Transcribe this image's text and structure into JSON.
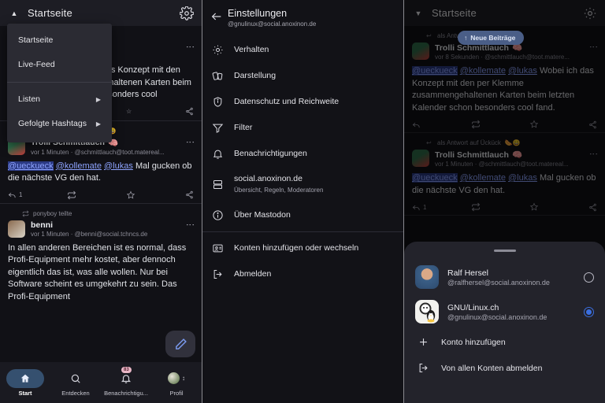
{
  "left": {
    "appbar": {
      "title": "Startseite",
      "chevron": "chevron-up",
      "gear": "gear-icon"
    },
    "menu": {
      "items": [
        {
          "label": "Startseite",
          "submenu": false
        },
        {
          "label": "Live-Feed",
          "submenu": false
        },
        {
          "label": "Listen",
          "submenu": true
        },
        {
          "label": "Gefolgte Hashtags",
          "submenu": true
        }
      ]
    },
    "posts": [
      {
        "context": "als Antwort auf Ückück",
        "name": "Trolli Schmittlauch",
        "handle": "vor 1 Minuten · @schmittlauch@toot.matereal...",
        "mentions": [
          "@ueckueck",
          "@kollemate",
          "@lukas"
        ],
        "text": "Mal gucken ob die nächste VG den hat.",
        "reply_count": "1"
      },
      {
        "context": "ponyboy teilte",
        "name": "benni",
        "handle": "vor 1 Minuten · @benni@social.tchncs.de",
        "mentions": [],
        "text": "In allen anderen Bereichen ist es normal, dass Profi-Equipment mehr kostet, aber dennoch eigentlich das ist, was alle wollen. Nur bei Software scheint es umgekehrt zu sein. Das Profi-Equipment",
        "reply_count": ""
      }
    ],
    "hidden_post": {
      "handle": "ittlauch@toot.matere...",
      "mentions": [
        "mate",
        "@lukas"
      ],
      "text": "Wobei ich das Konzept mit den per Klemme zusammengehaltenen Karten beim letzten Kalender schon besonders cool"
    },
    "fab": "compose-pencil-icon",
    "nav": [
      {
        "label": "Start",
        "icon": "home-icon",
        "selected": true,
        "badge": ""
      },
      {
        "label": "Entdecken",
        "icon": "search-icon",
        "selected": false,
        "badge": ""
      },
      {
        "label": "Benachrichtigu...",
        "icon": "bell-icon",
        "selected": false,
        "badge": "83"
      },
      {
        "label": "Profil",
        "icon": "avatar-icon",
        "selected": false,
        "badge": ""
      }
    ]
  },
  "middle": {
    "header": {
      "back": "back-arrow-icon",
      "title": "Einstellungen",
      "subtitle": "@gnulinux@social.anoxinon.de"
    },
    "items": [
      {
        "label": "Verhalten",
        "sub": "",
        "icon": "gear-icon"
      },
      {
        "label": "Darstellung",
        "sub": "",
        "icon": "palette-icon"
      },
      {
        "label": "Datenschutz und Reichweite",
        "sub": "",
        "icon": "shield-icon"
      },
      {
        "label": "Filter",
        "sub": "",
        "icon": "filter-icon"
      },
      {
        "label": "Benachrichtigungen",
        "sub": "",
        "icon": "bell-icon"
      },
      {
        "label": "social.anoxinon.de",
        "sub": "Übersicht, Regeln, Moderatoren",
        "icon": "server-icon"
      },
      {
        "label": "Über Mastodon",
        "sub": "",
        "icon": "info-icon"
      },
      {
        "label": "Konten hinzufügen oder wechseln",
        "sub": "",
        "icon": "switch-account-icon"
      },
      {
        "label": "Abmelden",
        "sub": "",
        "icon": "logout-icon"
      }
    ]
  },
  "right": {
    "appbar": {
      "title": "Startseite",
      "chevron": "chevron-down",
      "gear": "gear-icon"
    },
    "new_posts_pill": "Neue Beiträge",
    "posts": [
      {
        "context": "als Antwort auf",
        "name": "Trolli Schmittlauch",
        "handle": "vor 8 Sekunden · @schmittlauch@toot.matere...",
        "mentions": [
          "@ueckueck",
          "@kollemate",
          "@lukas"
        ],
        "text": "Wobei ich das Konzept mit den per Klemme zusammengehaltenen Karten beim letzten Kalender schon besonders cool fand.",
        "reply_count": ""
      },
      {
        "context": "als Antwort auf Ückück",
        "name": "Trolli Schmittlauch",
        "handle": "vor 1 Minuten · @schmittlauch@toot.matereal...",
        "mentions": [
          "@ueckueck",
          "@kollemate",
          "@lukas"
        ],
        "text": "Mal gucken ob die nächste VG den hat.",
        "reply_count": "1"
      }
    ],
    "sheet": {
      "accounts": [
        {
          "name": "Ralf Hersel",
          "handle": "@ralfhersel@social.anoxinon.de",
          "selected": false,
          "avatar": "photo-avatar"
        },
        {
          "name": "GNU/Linux.ch",
          "handle": "@gnulinux@social.anoxinon.de",
          "selected": true,
          "avatar": "gnu-linux-avatar"
        }
      ],
      "actions": [
        {
          "label": "Konto hinzufügen",
          "icon": "plus-icon"
        },
        {
          "label": "Von allen Konten abmelden",
          "icon": "logout-icon"
        }
      ]
    }
  },
  "colors": {
    "accent": "#3b6fe0",
    "pill": "#4a5e87",
    "nav_selected": "#35506f",
    "badge": "#e8b7c6",
    "mention": "#8ea4ff"
  }
}
